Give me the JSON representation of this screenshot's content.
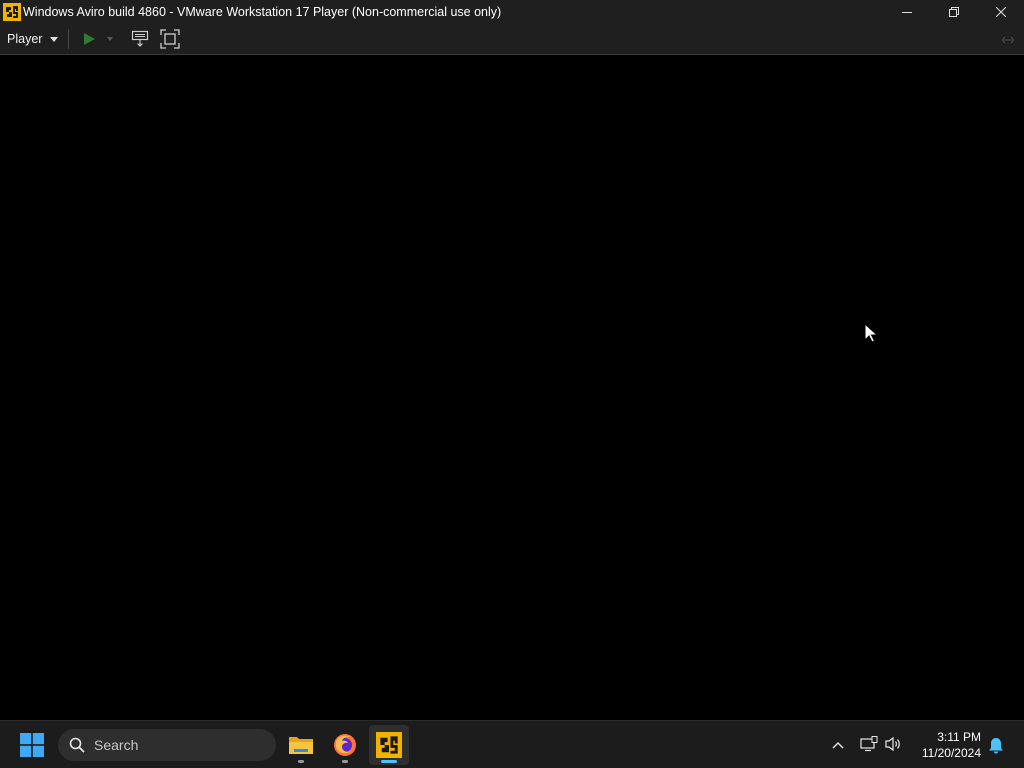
{
  "window": {
    "title": "Windows Aviro build 4860 - VMware Workstation 17 Player (Non-commercial use only)",
    "icon": "vmware-player-icon",
    "controls": [
      "minimize-icon",
      "restore-icon",
      "close-icon"
    ]
  },
  "toolbar": {
    "player_label": "Player",
    "buttons": [
      "play-icon",
      "dropdown-caret-icon",
      "send-ctrl-alt-del-icon",
      "fullscreen-icon",
      "unity-icon"
    ],
    "play_color": "#2e7d32"
  },
  "vm": {
    "background": "#000000",
    "cursor": "arrow-cursor-icon"
  },
  "taskbar": {
    "search_placeholder": "Search",
    "apps": [
      "file-explorer-icon",
      "firefox-icon",
      "vmware-player-icon"
    ],
    "active_app": "vmware-player-icon",
    "accent": "#4cc2ff",
    "time": "3:11 PM",
    "date": "11/20/2024"
  }
}
